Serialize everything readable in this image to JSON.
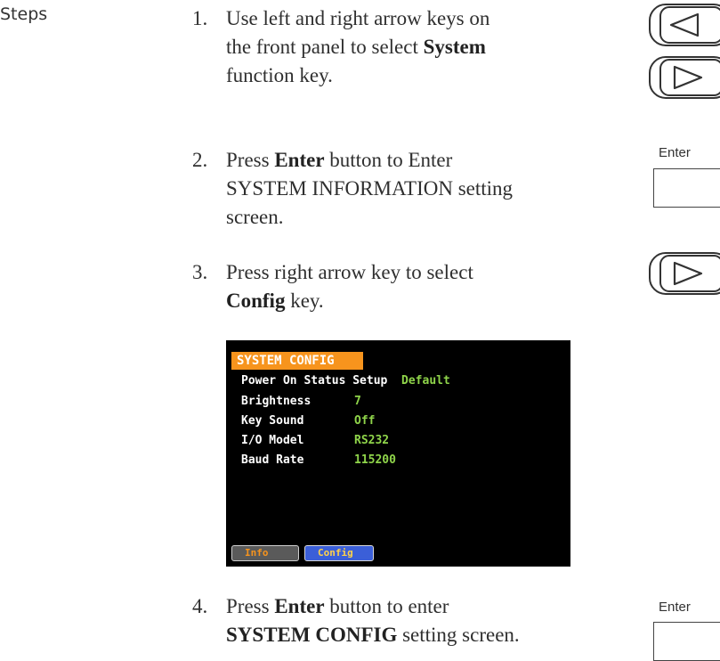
{
  "side_label": "Steps",
  "steps": [
    {
      "num": "1.",
      "line1": "Use left and right arrow keys on",
      "line2": "the front panel to select ",
      "line2_bold": "System",
      "line3": "function key."
    },
    {
      "num": "2.",
      "pre": "Press ",
      "bold": "Enter",
      "line1_post": " button to Enter",
      "line2": "SYSTEM INFORMATION setting",
      "line3": "screen."
    },
    {
      "num": "3.",
      "line1": "Press right arrow key to select",
      "line2_bold": "Config",
      "line2_post": " key."
    },
    {
      "num": "4.",
      "pre": "Press ",
      "bold": "Enter",
      "line1_post": " button to enter",
      "line2_bold": "SYSTEM CONFIG",
      "line2_post": " setting screen."
    }
  ],
  "keys": {
    "left_arrow_icon": "left-arrow-key",
    "right_arrow_icon": "right-arrow-key",
    "enter_label": "Enter"
  },
  "screen": {
    "title": "SYSTEM CONFIG",
    "rows": [
      {
        "label": "Power On Status Setup",
        "value": "Default"
      },
      {
        "label": "Brightness",
        "value": "7"
      },
      {
        "label": "Key Sound",
        "value": "Off"
      },
      {
        "label": "I/O Model",
        "value": "RS232"
      },
      {
        "label": "Baud Rate",
        "value": "115200"
      }
    ],
    "softkeys": [
      "Info",
      "Config"
    ],
    "colors": {
      "title_bg": "#f7941d",
      "value": "#8fd44a",
      "info_key": "#f7941d",
      "config_key": "#3b5fd8"
    }
  }
}
